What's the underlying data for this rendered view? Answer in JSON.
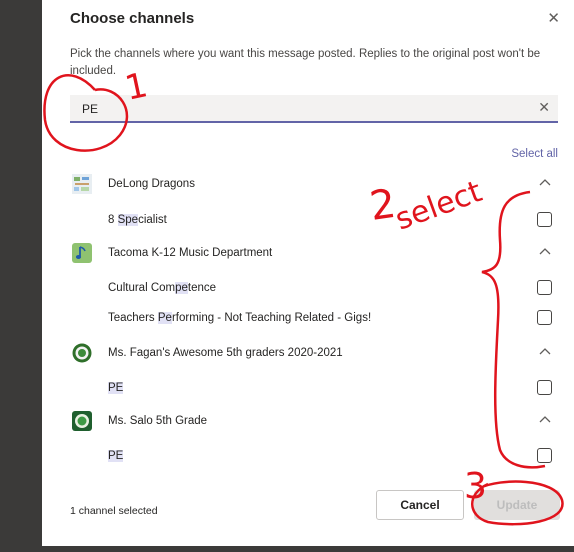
{
  "dialog": {
    "title": "Choose channels",
    "description": "Pick the channels where you want this message posted. Replies to the original post won't be included.",
    "close_icon": "close-icon"
  },
  "search": {
    "value": "PE",
    "clear_icon": "close-icon"
  },
  "select_all": "Select all",
  "teams": [
    {
      "name": "DeLong Dragons",
      "icon": "team-image-icon",
      "channels": [
        {
          "pre": "8 ",
          "hl": "Spe",
          "post": "cialist"
        }
      ]
    },
    {
      "name": "Tacoma K-12 Music Department",
      "icon": "music-note-icon",
      "channels": [
        {
          "pre": "Cultural Com",
          "hl": "pe",
          "post": "tence"
        },
        {
          "pre": "Teachers ",
          "hl": "Pe",
          "post": "rforming - Not Teaching Related - Gigs!"
        }
      ]
    },
    {
      "name": "Ms. Fagan's Awesome 5th graders 2020-2021",
      "icon": "team-logo-icon",
      "channels": [
        {
          "pre": "",
          "hl": "PE",
          "post": ""
        }
      ]
    },
    {
      "name": "Ms. Salo 5th Grade",
      "icon": "team-logo-icon",
      "channels": [
        {
          "pre": "",
          "hl": "PE",
          "post": ""
        }
      ]
    }
  ],
  "footer": {
    "status": "1 channel selected",
    "cancel_label": "Cancel",
    "update_label": "Update"
  },
  "annotations": {
    "mark_1": "1",
    "mark_2": "2",
    "mark_select": "select",
    "mark_3": "3"
  },
  "colors": {
    "accent": "#6264a7",
    "highlight": "#e1e1f5",
    "annotation": "#e0141d"
  }
}
